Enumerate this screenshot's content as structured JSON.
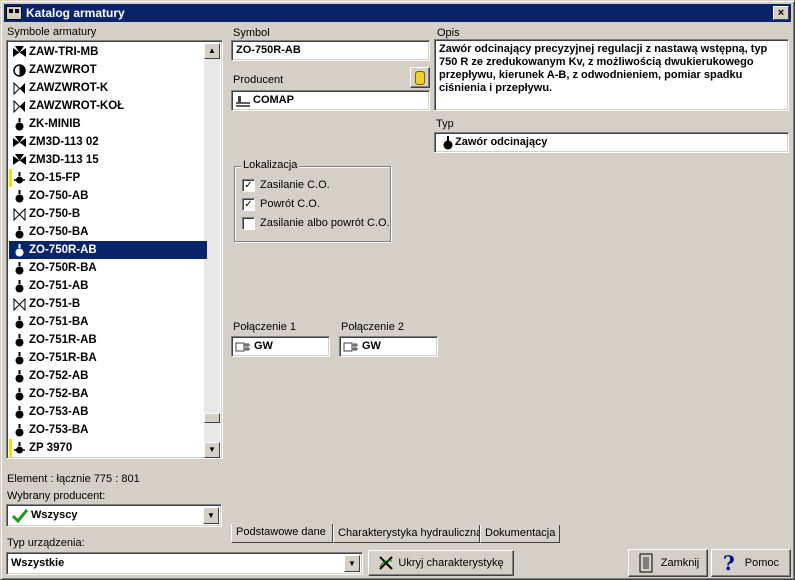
{
  "window": {
    "title": "Katalog armatury",
    "close_label": "×"
  },
  "left": {
    "list_label": "Symbole armatury",
    "items": [
      {
        "label": "ZAW-TRI-MB",
        "icon": "valve-three-way-icon"
      },
      {
        "label": "ZAWZWROT",
        "icon": "check-valve-round-icon"
      },
      {
        "label": "ZAWZWROT-K",
        "icon": "check-valve-bowtie-icon"
      },
      {
        "label": "ZAWZWROT-KOŁ",
        "icon": "check-valve-bowtie-icon"
      },
      {
        "label": "ZK-MINIB",
        "icon": "shutoff-valve-icon"
      },
      {
        "label": "ZM3D-113 02",
        "icon": "valve-three-way-icon"
      },
      {
        "label": "ZM3D-113 15",
        "icon": "valve-three-way-icon"
      },
      {
        "label": "ZO-15-FP",
        "icon": "flow-valve-marked-icon"
      },
      {
        "label": "ZO-750-AB",
        "icon": "shutoff-valve-icon"
      },
      {
        "label": "ZO-750-B",
        "icon": "gate-valve-icon"
      },
      {
        "label": "ZO-750-BA",
        "icon": "shutoff-valve-icon"
      },
      {
        "label": "ZO-750R-AB",
        "icon": "shutoff-valve-icon"
      },
      {
        "label": "ZO-750R-BA",
        "icon": "shutoff-valve-icon"
      },
      {
        "label": "ZO-751-AB",
        "icon": "shutoff-valve-icon"
      },
      {
        "label": "ZO-751-B",
        "icon": "gate-valve-icon"
      },
      {
        "label": "ZO-751-BA",
        "icon": "shutoff-valve-icon"
      },
      {
        "label": "ZO-751R-AB",
        "icon": "shutoff-valve-icon"
      },
      {
        "label": "ZO-751R-BA",
        "icon": "shutoff-valve-icon"
      },
      {
        "label": "ZO-752-AB",
        "icon": "shutoff-valve-icon"
      },
      {
        "label": "ZO-752-BA",
        "icon": "shutoff-valve-icon"
      },
      {
        "label": "ZO-753-AB",
        "icon": "shutoff-valve-icon"
      },
      {
        "label": "ZO-753-BA",
        "icon": "shutoff-valve-icon"
      },
      {
        "label": "ZP 3970",
        "icon": "flow-valve-marked-icon"
      }
    ],
    "selected_index": 11,
    "element_count_text": "Element : łącznie  775 : 801",
    "producer_label": "Wybrany producent:",
    "producer_value": "Wszyscy",
    "device_type_label": "Typ urządzenia:",
    "device_type_value": "Wszystkie"
  },
  "detail": {
    "symbol_label": "Symbol",
    "symbol_value": "ZO-750R-AB",
    "producer_label": "Producent",
    "producer_value": "COMAP",
    "description_label": "Opis",
    "description_value": "Zawór odcinający precyzyjnej regulacji z nastawą wstępną, typ 750 R ze zredukowanym Kv, z możliwością dwukierukowego przepływu, kierunek A-B, z odwodnieniem, pomiar spadku ciśnienia i przepływu.",
    "type_label": "Typ",
    "type_value": "Zawór odcinający",
    "location_group_label": "Lokalizacja",
    "location_options": [
      {
        "label": "Zasilanie C.O.",
        "checked": true
      },
      {
        "label": "Powrót C.O.",
        "checked": true
      },
      {
        "label": "Zasilanie albo powrót C.O.",
        "checked": false
      }
    ],
    "connection1_label": "Połączenie 1",
    "connection1_value": "GW",
    "connection2_label": "Połączenie 2",
    "connection2_value": "GW"
  },
  "tabs": [
    "Podstawowe dane",
    "Charakterystyka hydrauliczna",
    "Dokumentacja"
  ],
  "active_tab": 0,
  "buttons": {
    "hide_characteristic": "Ukryj charakterystykę",
    "close": "Zamknij",
    "help": "Pomoc"
  },
  "colors": {
    "selection": "#0a246a",
    "window_bg": "#d4d0c8",
    "marker_yellow": "#e8e020"
  }
}
